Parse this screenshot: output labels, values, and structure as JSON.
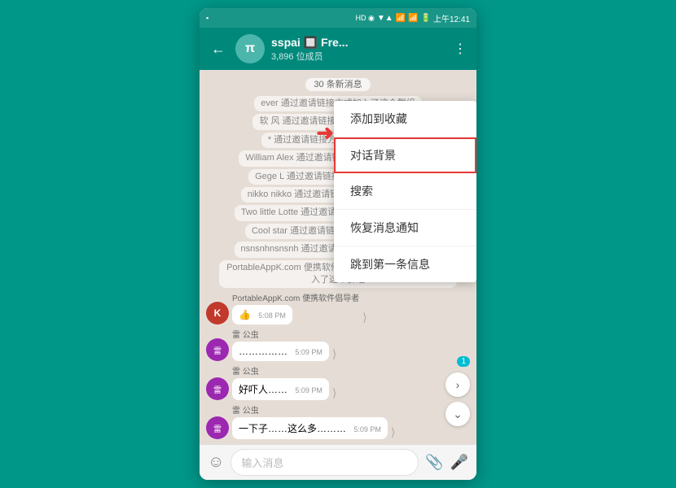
{
  "statusBar": {
    "left": "▪",
    "time": "上午12:41",
    "icons": [
      "HD◉",
      "▼▲",
      "📶",
      "📶",
      "🔋"
    ]
  },
  "header": {
    "title": "sspai 🔲 Fre...",
    "subtitle": "3,896 位成员",
    "backIcon": "←",
    "avatarText": "π"
  },
  "chat": {
    "newMsgsBanner": "30 条新消息",
    "systemMessages": [
      "ever 通过邀请链接方式加入了这个群组",
      "软 风 通过邀请链接方式加入了这个群组",
      "* 通过邀请链接方式加入了这个群组",
      "William Alex 通过邀请链接方式加入了这个群组",
      "Gege L 通过邀请链接方式加入了这个群组",
      "nikko nikko 通过邀请链接方式加入了这个群组",
      "Two little Lotte 通过邀请链接方式加入了这个群组",
      "Cool star 通过邀请链接方式加入了这个群组",
      "nsnsnhnsnsnh 通过邀请链接方式加入了这个群组",
      "PortableAppK.com 便携软件倡导者 通过邀请链接方式加入了这个群组"
    ],
    "messages": [
      {
        "id": 1,
        "sender": "PortableAppK.com 便携软件倡导者",
        "avatar": "K",
        "avatarColor": "#c0392b",
        "text": "👍",
        "time": "5:08 PM",
        "side": "left"
      },
      {
        "id": 2,
        "sender": "雷 公虫",
        "avatar": "雷",
        "avatarColor": "#7b68ee",
        "text": "……………",
        "time": "5:09 PM",
        "side": "left"
      },
      {
        "id": 3,
        "sender": "雷 公虫",
        "avatar": "雷",
        "avatarColor": "#7b68ee",
        "text": "好吓人……",
        "time": "5:09 PM",
        "side": "left"
      },
      {
        "id": 4,
        "sender": "雷 公虫",
        "avatar": "雷",
        "avatarColor": "#7b68ee",
        "text": "一下子……这么多………",
        "time": "5:09 PM",
        "side": "left"
      }
    ],
    "inputPlaceholder": "输入消息",
    "scrollBadge": "1"
  },
  "dropdownMenu": {
    "items": [
      {
        "id": "favorites",
        "label": "添加到收藏",
        "highlighted": false
      },
      {
        "id": "background",
        "label": "对话背景",
        "highlighted": true
      },
      {
        "id": "search",
        "label": "搜索",
        "highlighted": false
      },
      {
        "id": "restore-notify",
        "label": "恢复消息通知",
        "highlighted": false
      },
      {
        "id": "jump-first",
        "label": "跳到第一条信息",
        "highlighted": false
      }
    ]
  },
  "arrow": "→"
}
